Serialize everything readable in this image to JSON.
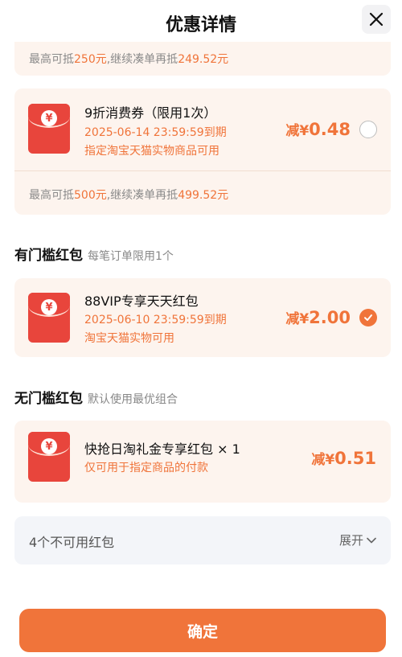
{
  "header": {
    "title": "优惠详情"
  },
  "top_strip": {
    "prefix": "最高可抵",
    "amount": "250元",
    "middle": ",继续凑单再抵",
    "amount2": "249.52元"
  },
  "coupon1": {
    "icon": "red-envelope-icon",
    "title": "9折消费券（限用1次）",
    "expiry": "2025-06-14 23:59:59到期",
    "scope": "指定淘宝天猫实物商品可用",
    "amount_prefix": "减¥",
    "amount": "0.48",
    "selected": false,
    "note_prefix": "最高可抵",
    "note_amount": "500元",
    "note_middle": ",继续凑单再抵",
    "note_amount2": "499.52元"
  },
  "section_threshold": {
    "title": "有门槛红包",
    "subtitle": "每笔订单限用1个"
  },
  "coupon2": {
    "title": "88VIP专享天天红包",
    "expiry": "2025-06-10 23:59:59到期",
    "scope": "淘宝天猫实物可用",
    "amount_prefix": "减¥",
    "amount": "2.00",
    "selected": true
  },
  "section_no_threshold": {
    "title": "无门槛红包",
    "subtitle": "默认使用最优组合"
  },
  "coupon3": {
    "title": "快抢日淘礼金专享红包 × 1",
    "scope": "仅可用于指定商品的付款",
    "amount_prefix": "减¥",
    "amount": "0.51"
  },
  "unavailable": {
    "label": "4个不可用红包",
    "expand": "展开"
  },
  "confirm": {
    "label": "确定"
  },
  "colors": {
    "accent": "#f0743a",
    "envelope": "#e8453c",
    "card_bg": "#fdf4ee"
  }
}
